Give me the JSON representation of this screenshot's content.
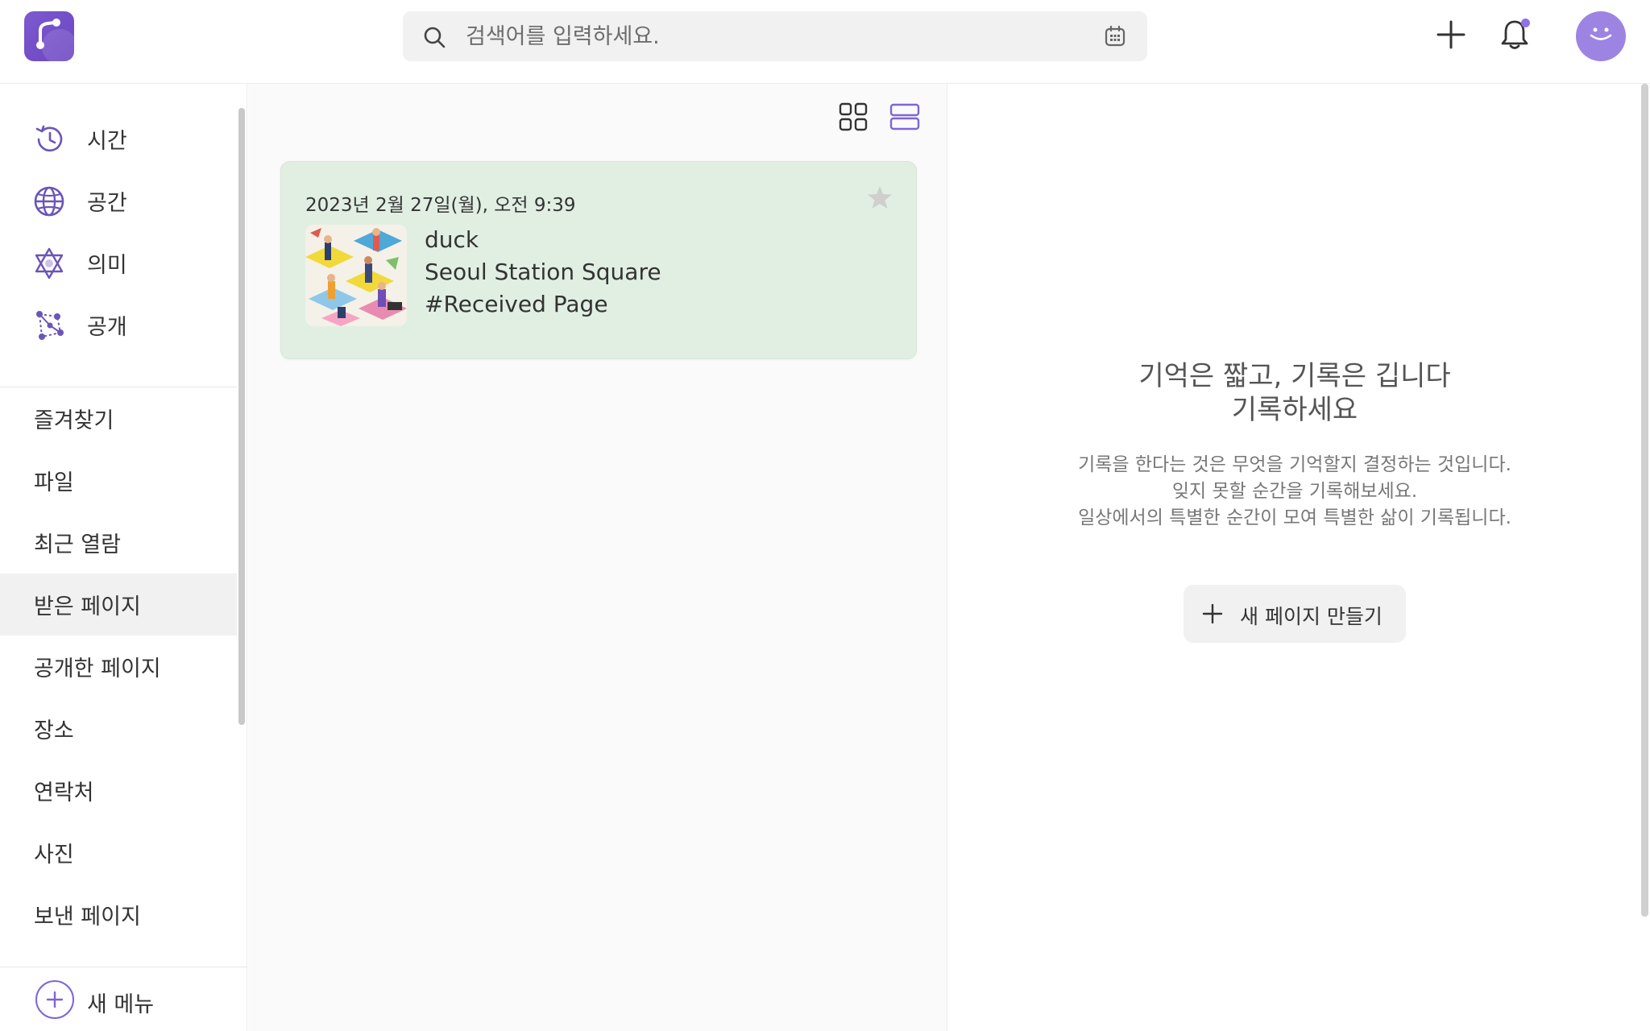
{
  "header": {
    "search": {
      "placeholder": "검색어를 입력하세요."
    },
    "icons": [
      "app-logo-icon",
      "search-icon",
      "calendar-icon",
      "plus-icon",
      "bell-icon",
      "avatar-smile-icon"
    ],
    "accent_color": "#7f65d6"
  },
  "sidebar": {
    "nav": [
      {
        "label": "시간",
        "icon": "history-icon"
      },
      {
        "label": "공간",
        "icon": "globe-icon"
      },
      {
        "label": "의미",
        "icon": "hexagram-icon"
      },
      {
        "label": "공개",
        "icon": "share-network-icon"
      }
    ],
    "menu": [
      {
        "label": "즐겨찾기"
      },
      {
        "label": "파일"
      },
      {
        "label": "최근 열람"
      },
      {
        "label": "받은 페이지",
        "active": true
      },
      {
        "label": "공개한 페이지"
      },
      {
        "label": "장소"
      },
      {
        "label": "연락처"
      },
      {
        "label": "사진"
      },
      {
        "label": "보낸 페이지"
      }
    ],
    "new_menu_label": "새 메뉴"
  },
  "list": {
    "view_modes": [
      "grid-view-icon",
      "list-view-icon"
    ],
    "cards": [
      {
        "date": "2023년 2월 27일(월), 오전 9:39",
        "title": "duck",
        "location": "Seoul Station Square",
        "tag": "#Received Page",
        "starred": false,
        "bg_color": "#e1efe3"
      }
    ]
  },
  "detail": {
    "headline_1": "기억은 짧고, 기록은 깁니다",
    "headline_2": "기록하세요",
    "desc_1": "기록을 한다는 것은 무엇을 기억할지 결정하는 것입니다.",
    "desc_2": "잊지 못할 순간을 기록해보세요.",
    "desc_3": "일상에서의 특별한 순간이 모여 특별한 삶이 기록됩니다.",
    "new_page_label": "새 페이지 만들기"
  }
}
